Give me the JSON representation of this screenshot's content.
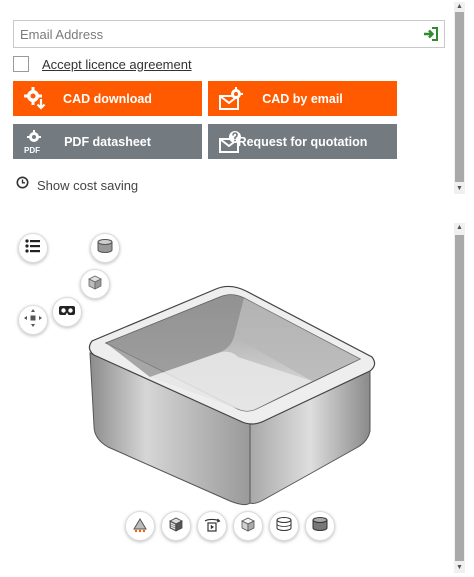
{
  "email": {
    "placeholder": "Email Address",
    "value": ""
  },
  "licence": {
    "label": "Accept licence agreement",
    "checked": false
  },
  "buttons": {
    "cad_download": "CAD download",
    "cad_by_email": "CAD by email",
    "pdf_datasheet": "PDF datasheet",
    "request_quote": "Request for quotation"
  },
  "icon_text": {
    "pdf": "PDF"
  },
  "cost_saving": {
    "label": "Show cost saving"
  },
  "colors": {
    "accent": "#ff5a00",
    "secondary": "#737a80",
    "submit_icon": "#2e8b2e"
  },
  "viewer_tools": {
    "left": [
      "list-icon",
      "cylinder-icon",
      "cube-icon",
      "vr-glasses-icon",
      "explode-icon"
    ],
    "bottom": [
      "measure-icon",
      "section-cube-icon",
      "rotate-play-icon",
      "wireframe-cube-icon",
      "outline-cylinder-icon",
      "shaded-cylinder-icon"
    ]
  }
}
